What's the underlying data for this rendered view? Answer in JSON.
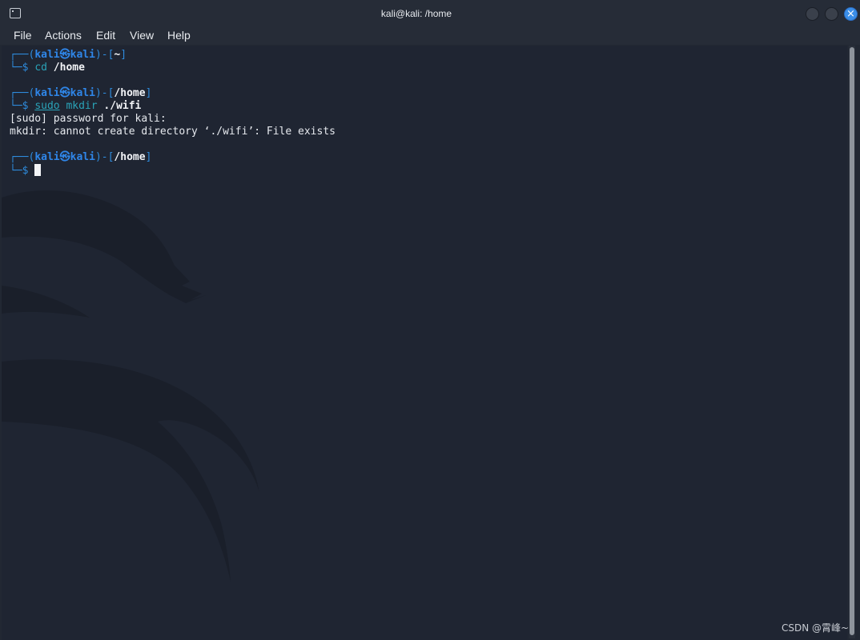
{
  "window": {
    "title": "kali@kali: /home",
    "close_glyph": "×"
  },
  "menu": {
    "items": [
      "File",
      "Actions",
      "Edit",
      "View",
      "Help"
    ]
  },
  "terminal": {
    "prompt1": {
      "frame_open": "┌──(",
      "user": "kali㉿kali",
      "mid": ")-[",
      "path": "~",
      "frame_close": "]",
      "prompt_char": "└─$ ",
      "command": "cd",
      "argument": " /home"
    },
    "prompt2": {
      "frame_open": "┌──(",
      "user": "kali㉿kali",
      "mid": ")-[",
      "path": "/home",
      "frame_close": "]",
      "prompt_char": "└─$ ",
      "sudo": "sudo",
      "command": " mkdir",
      "argument": " ./wifi"
    },
    "output1": "[sudo] password for kali:",
    "output2": "mkdir: cannot create directory ‘./wifi’: File exists",
    "prompt3": {
      "frame_open": "┌──(",
      "user": "kali㉿kali",
      "mid": ")-[",
      "path": "/home",
      "frame_close": "]",
      "prompt_char": "└─$ "
    }
  },
  "watermark": "CSDN @霄峰~",
  "colors": {
    "background": "#1f2532",
    "prompt_frame": "#2e8bdc",
    "prompt_user": "#2f86e8",
    "command": "#2aa3b8",
    "close_button": "#3b8ee8"
  },
  "icons": {
    "app": "terminal-icon",
    "background_art": "kali-dragon-icon"
  }
}
